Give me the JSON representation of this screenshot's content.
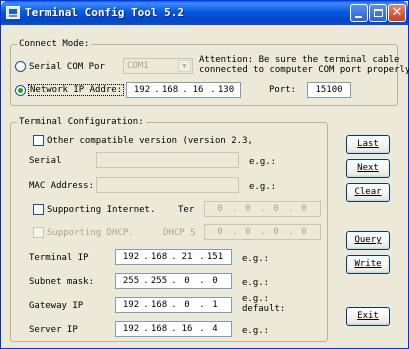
{
  "window": {
    "title": "Terminal Config Tool 5.2"
  },
  "connect": {
    "legend": "Connect Mode:",
    "attention_line1": "Attention: Be sure the terminal cable",
    "attention_line2": "connected to computer COM port properly.",
    "serial_label": "Serial COM Por",
    "com_value": "COM1",
    "network_label": "Network IP Addre:",
    "network_ip": [
      "192",
      "168",
      "16",
      "130"
    ],
    "port_label": "Port:",
    "port_value": "15100"
  },
  "terminal": {
    "legend": "Terminal Configuration:",
    "other_version_label": "Other compatible version (version 2.3,",
    "serial_label": "Serial",
    "serial_eg": "e.g.:",
    "mac_label": "MAC Address:",
    "mac_eg": "e.g.:",
    "internet_label": "Supporting Internet.",
    "ter_label": "Ter",
    "ter_ip": [
      "0",
      "0",
      "0",
      "0"
    ],
    "dhcp_label": "Supporting DHCP.",
    "dhcp_s_label": "DHCP S",
    "dhcp_ip": [
      "0",
      "0",
      "0",
      "0"
    ],
    "terminal_ip_label": "Terminal IP",
    "terminal_ip": [
      "192",
      "168",
      "21",
      "151"
    ],
    "terminal_ip_eg": "e.g.:",
    "subnet_label": "Subnet mask:",
    "subnet_ip": [
      "255",
      "255",
      "0",
      "0"
    ],
    "subnet_eg": "e.g.:",
    "gateway_label": "Gateway IP",
    "gateway_ip": [
      "192",
      "168",
      "0",
      "1"
    ],
    "gateway_eg": "e.g.:",
    "gateway_default": "default:",
    "server_label": "Server IP",
    "server_ip": [
      "192",
      "168",
      "16",
      "4"
    ],
    "server_eg": "e.g.:"
  },
  "buttons": {
    "last": "Last",
    "next": "Next",
    "clear": "Clear",
    "query": "Query",
    "write": "Write",
    "exit": "Exit"
  }
}
